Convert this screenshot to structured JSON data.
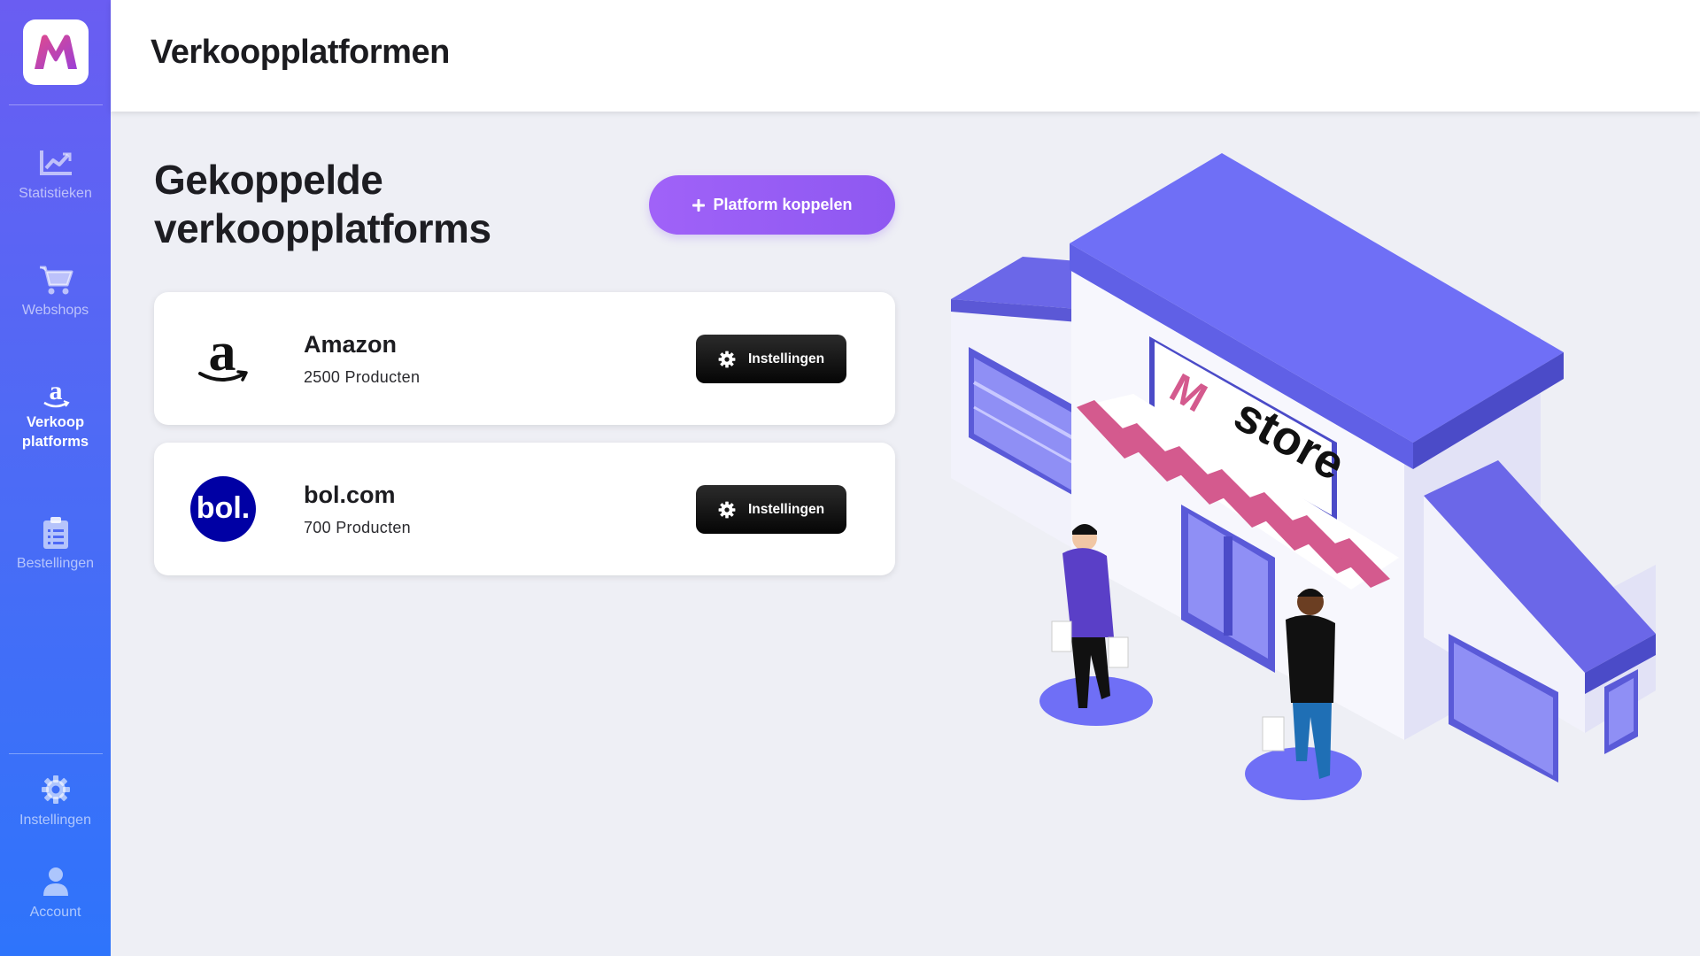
{
  "app": {
    "page_title": "Verkoopplatformen"
  },
  "sidebar": {
    "logo_letter": "M",
    "items": [
      {
        "label": "Statistieken",
        "icon": "chart-line-icon",
        "active": false
      },
      {
        "label": "Webshops",
        "icon": "shopping-cart-icon",
        "active": false
      },
      {
        "label": "Verkoop platforms",
        "icon": "amazon-icon",
        "active": true
      },
      {
        "label": "Bestellingen",
        "icon": "clipboard-list-icon",
        "active": false
      },
      {
        "label": "Instellingen",
        "icon": "gear-icon",
        "active": false
      },
      {
        "label": "Account",
        "icon": "user-icon",
        "active": false
      }
    ]
  },
  "main": {
    "section_title": "Gekoppelde verkoopplatforms",
    "add_button_label": "Platform koppelen",
    "platforms": [
      {
        "name": "Amazon",
        "products": "2500 Producten",
        "settings_label": "Instellingen",
        "logo": "amazon-logo"
      },
      {
        "name": "bol.com",
        "products": "700 Producten",
        "settings_label": "Instellingen",
        "logo": "bol-logo",
        "logo_text": "bol."
      }
    ]
  },
  "illustration": {
    "sign_text": "store",
    "sign_letter": "M"
  },
  "colors": {
    "sidebar_top": "#6a5df2",
    "sidebar_bottom": "#2e74fb",
    "accent_purple": "#9a5ff6",
    "store_roof": "#6e6ef5",
    "awning_pink": "#d45a8e",
    "bol_blue": "#0000a4"
  }
}
